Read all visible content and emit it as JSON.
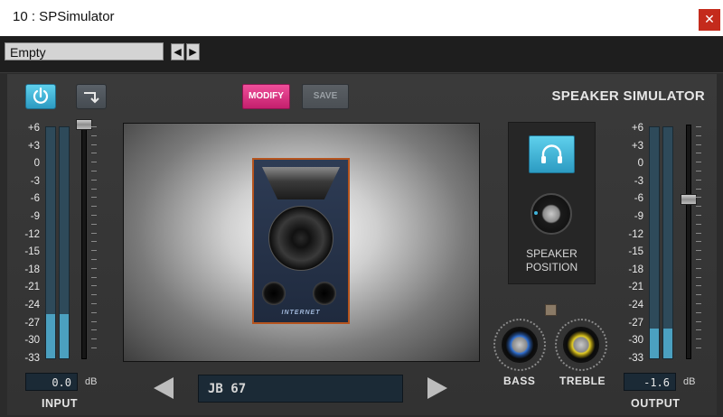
{
  "window": {
    "title": "10 : SPSimulator",
    "close_glyph": "✕"
  },
  "preset": {
    "name": "Empty",
    "prev_glyph": "◀",
    "next_glyph": "▶"
  },
  "toolbar": {
    "modify_label": "MODIFY",
    "save_label": "SAVE"
  },
  "plugin_title": "SPEAKER SIMULATOR",
  "scale_ticks": [
    "+6",
    "+3",
    "0",
    "-3",
    "-6",
    "-9",
    "-12",
    "-15",
    "-18",
    "-21",
    "-24",
    "-27",
    "-30",
    "-33"
  ],
  "input": {
    "label": "INPUT",
    "value": "0.0",
    "unit": "dB",
    "meter_levels_fraction": [
      0.19,
      0.19
    ],
    "fader_level_fraction": 1.0
  },
  "output": {
    "label": "OUTPUT",
    "value": "-1.6",
    "unit": "dB",
    "meter_levels_fraction": [
      0.13,
      0.13
    ],
    "fader_level_fraction": 0.72
  },
  "speaker": {
    "model": "JB 67",
    "brand": "INTERNET"
  },
  "position": {
    "label_line1": "SPEAKER",
    "label_line2": "POSITION"
  },
  "knobs": {
    "bass_label": "BASS",
    "treble_label": "TREBLE"
  },
  "colors": {
    "accent_cyan": "#3fb4da",
    "modify_pink": "#e2357f",
    "cabinet_trim": "#b5541e",
    "bass_ring": "#2f6fd0",
    "treble_ring": "#e3cd26"
  },
  "icons": [
    "power-icon",
    "bypass-arrow-icon",
    "headphones-icon",
    "close-icon"
  ]
}
